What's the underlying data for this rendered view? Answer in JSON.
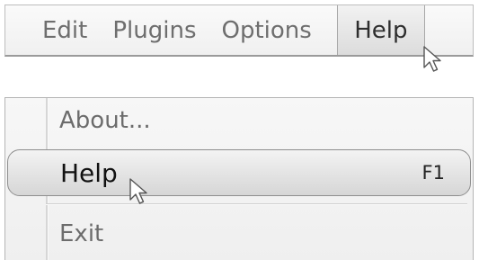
{
  "menubar": {
    "items": [
      {
        "label": "Edit"
      },
      {
        "label": "Plugins"
      },
      {
        "label": "Options"
      },
      {
        "label": "Help",
        "active": true
      }
    ]
  },
  "help_menu": {
    "items": [
      {
        "label": "About..."
      },
      {
        "label": "Help",
        "shortcut": "F1",
        "highlighted": true
      },
      {
        "label": "Exit"
      }
    ]
  },
  "colors": {
    "text_inactive": "#6e6e6e",
    "text_active": "#111111",
    "border": "#a8a8a8",
    "highlight_fill": "#e3e3e3"
  },
  "icons": [
    "arrow-cursor-icon"
  ]
}
